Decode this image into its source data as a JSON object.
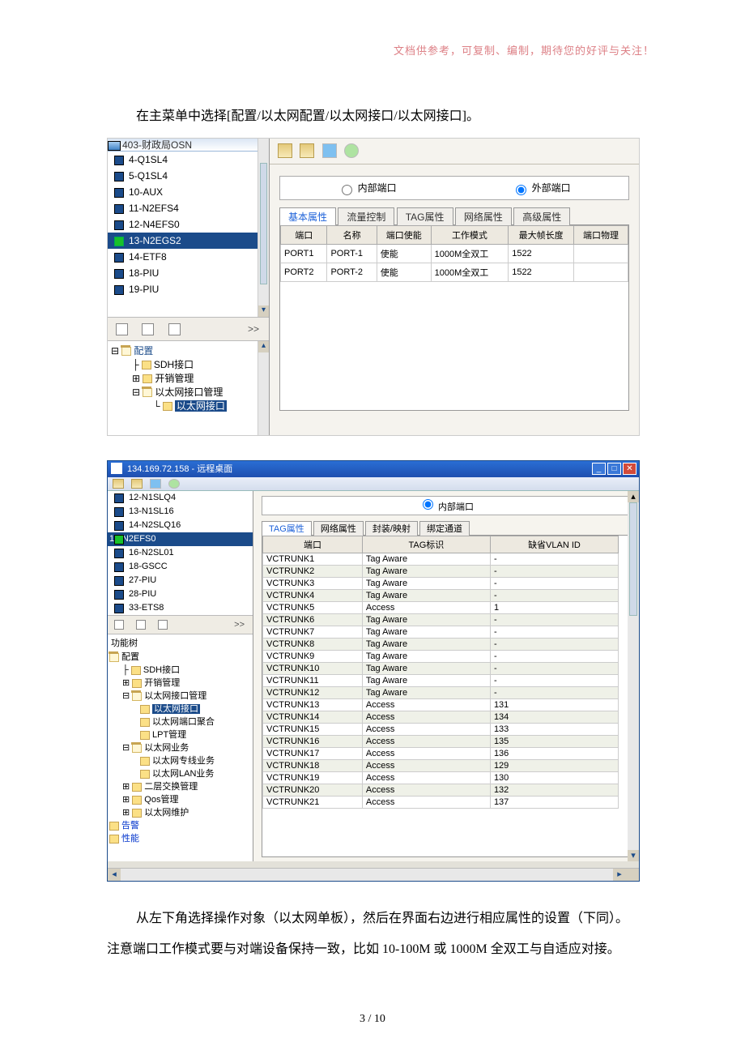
{
  "doc": {
    "header_note": "文档供参考，可复制、编制，期待您的好评与关注！",
    "para1": "在主菜单中选择[配置/以太网配置/以太网接口/以太网接口]。",
    "para2": "从左下角选择操作对象（以太网单板），然后在界面右边进行相应属性的设置（下同）。",
    "para3": "注意端口工作模式要与对端设备保持一致，比如 10-100M 或 1000M 全双工与自适应对接。",
    "footer": "3  /  10"
  },
  "shot1": {
    "left_title": "403-财政局OSN",
    "slots": [
      "4-Q1SL4",
      "5-Q1SL4",
      "10-AUX",
      "11-N2EFS4",
      "12-N4EFS0",
      "13-N2EGS2",
      "14-ETF8",
      "18-PIU",
      "19-PIU"
    ],
    "selected_slot": "13-N2EGS2",
    "tool_expand": ">>",
    "tree": {
      "root": "配置",
      "n_sdh": "SDH接口",
      "n_open": "开销管理",
      "n_ethmgr": "以太网接口管理",
      "n_ethif": "以太网接口"
    },
    "toolbar_icons": [
      "db-icon",
      "layout-icon",
      "print-icon",
      "help-icon"
    ],
    "radio": {
      "inner": "内部端口",
      "outer": "外部端口"
    },
    "tabs": [
      "基本属性",
      "流量控制",
      "TAG属性",
      "网络属性",
      "高级属性"
    ],
    "table": {
      "headers": [
        "端口",
        "名称",
        "端口使能",
        "工作模式",
        "最大帧长度",
        "端口物理"
      ],
      "rows": [
        [
          "PORT1",
          "PORT-1",
          "使能",
          "1000M全双工",
          "1522",
          ""
        ],
        [
          "PORT2",
          "PORT-2",
          "使能",
          "1000M全双工",
          "1522",
          ""
        ]
      ]
    }
  },
  "shot2": {
    "title": "134.169.72.158 - 远程桌面",
    "slots": [
      {
        "t": "12-N1SLQ4",
        "g": false
      },
      {
        "t": "13-N1SL16",
        "g": false
      },
      {
        "t": "14-N2SLQ16",
        "g": false
      },
      {
        "t": "15-N2EFS0",
        "g": true,
        "sel": true
      },
      {
        "t": "16-N2SL01",
        "g": false
      },
      {
        "t": "18-GSCC",
        "g": false
      },
      {
        "t": "27-PIU",
        "g": false
      },
      {
        "t": "28-PIU",
        "g": false
      },
      {
        "t": "33-ETS8",
        "g": false
      }
    ],
    "tool_expand": ">>",
    "tree_label": "功能树",
    "tree": {
      "root": "配置",
      "sdh": "SDH接口",
      "open": "开销管理",
      "ethmgr": "以太网接口管理",
      "ethif": "以太网接口",
      "ethagg": "以太网端口聚合",
      "lpt": "LPT管理",
      "ethbiz": "以太网业务",
      "ethline": "以太网专线业务",
      "ethlan": "以太网LAN业务",
      "l2": "二层交换管理",
      "qos": "Qos管理",
      "ethmaint": "以太网维护",
      "alarm": "告警",
      "perf": "性能"
    },
    "radio": {
      "inner": "内部端口"
    },
    "tabs": [
      "TAG属性",
      "网络属性",
      "封装/映射",
      "绑定通道"
    ],
    "table": {
      "headers": [
        "端口",
        "TAG标识",
        "缺省VLAN ID"
      ],
      "rows": [
        [
          "VCTRUNK1",
          "Tag Aware",
          "-"
        ],
        [
          "VCTRUNK2",
          "Tag Aware",
          "-"
        ],
        [
          "VCTRUNK3",
          "Tag Aware",
          "-"
        ],
        [
          "VCTRUNK4",
          "Tag Aware",
          "-"
        ],
        [
          "VCTRUNK5",
          "Access",
          "1"
        ],
        [
          "VCTRUNK6",
          "Tag Aware",
          "-"
        ],
        [
          "VCTRUNK7",
          "Tag Aware",
          "-"
        ],
        [
          "VCTRUNK8",
          "Tag Aware",
          "-"
        ],
        [
          "VCTRUNK9",
          "Tag Aware",
          "-"
        ],
        [
          "VCTRUNK10",
          "Tag Aware",
          "-"
        ],
        [
          "VCTRUNK11",
          "Tag Aware",
          "-"
        ],
        [
          "VCTRUNK12",
          "Tag Aware",
          "-"
        ],
        [
          "VCTRUNK13",
          "Access",
          "131"
        ],
        [
          "VCTRUNK14",
          "Access",
          "134"
        ],
        [
          "VCTRUNK15",
          "Access",
          "133"
        ],
        [
          "VCTRUNK16",
          "Access",
          "135"
        ],
        [
          "VCTRUNK17",
          "Access",
          "136"
        ],
        [
          "VCTRUNK18",
          "Access",
          "129"
        ],
        [
          "VCTRUNK19",
          "Access",
          "130"
        ],
        [
          "VCTRUNK20",
          "Access",
          "132"
        ],
        [
          "VCTRUNK21",
          "Access",
          "137"
        ]
      ]
    }
  }
}
